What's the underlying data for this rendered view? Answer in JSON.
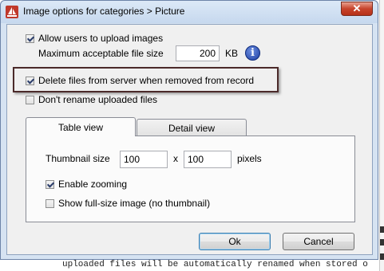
{
  "window": {
    "title": "Image options for categories > Picture",
    "close_glyph": "✕",
    "icon": "app-sailboat-icon"
  },
  "options": {
    "allow_upload_label": "Allow users to upload images",
    "allow_upload_checked": true,
    "max_size_label": "Maximum acceptable file size",
    "max_size_value": "200",
    "max_size_unit": "KB",
    "info_glyph": "i",
    "delete_files_label": "Delete files from server when removed from record",
    "delete_files_checked": true,
    "dont_rename_label": "Don't rename uploaded files",
    "dont_rename_checked": false
  },
  "tabs": [
    {
      "label": "Table view",
      "active": true
    },
    {
      "label": "Detail view",
      "active": false
    }
  ],
  "table_view": {
    "thumb_size_label": "Thumbnail size",
    "thumb_width": "100",
    "times_label": "x",
    "thumb_height": "100",
    "unit_label": "pixels",
    "enable_zoom_label": "Enable zooming",
    "enable_zoom_checked": true,
    "full_size_label": "Show full-size image (no thumbnail)",
    "full_size_checked": false
  },
  "buttons": {
    "ok_label": "Ok",
    "cancel_label": "Cancel"
  },
  "background": {
    "partial_text": "uploaded files will be automatically renamed when stored o"
  },
  "colors": {
    "accent_highlight_border": "#4b2a2a",
    "info_icon": "#1e3fa3",
    "close_button": "#c7432b"
  }
}
